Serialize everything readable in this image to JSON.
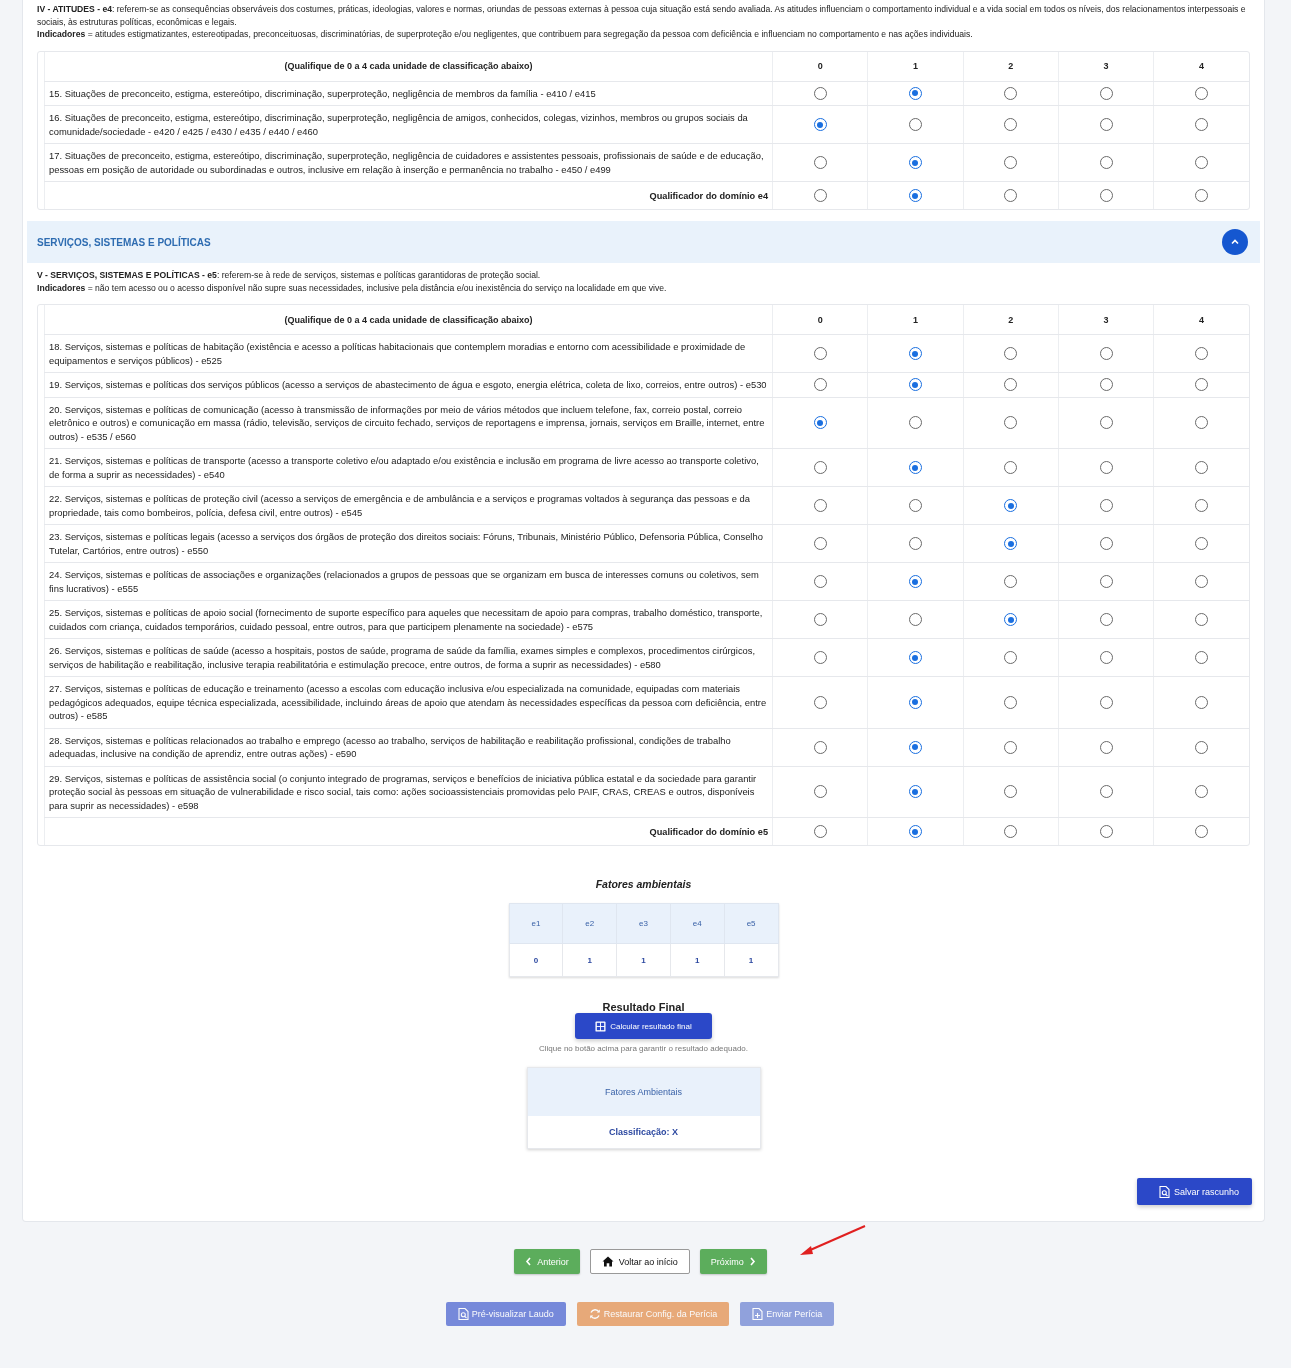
{
  "sections": [
    {
      "paragraphs": [
        "**IV - ATITUDES - e4**: referem-se as consequências observáveis dos costumes, práticas, ideologias, valores e normas, oriundas de pessoas externas à pessoa cuja situação está sendo avaliada. As atitudes influenciam o comportamento individual e a vida social em todos os níveis, dos relacionamentos interpessoais e sociais, às estruturas políticas, econômicas e legais.",
        "**Indicadores** = atitudes estigmatizantes, estereotipadas, preconceituosas, discriminatórias, de superproteção e/ou negligentes, que contribuem para segregação da pessoa com deficiência e influenciam no comportamento e nas ações individuais."
      ],
      "table": {
        "header": "(Qualifique de 0 a 4 cada unidade de classificação abaixo)",
        "scale": [
          "0",
          "1",
          "2",
          "3",
          "4"
        ],
        "rows": [
          {
            "text": "15. Situações de preconceito, estigma, estereótipo, discriminação, superproteção, negligência de membros da família - e410 / e415",
            "choices": [
              {
                "selected": false
              },
              {
                "selected": true
              },
              {
                "selected": false
              },
              {
                "selected": false
              },
              {
                "selected": false
              }
            ]
          },
          {
            "text": "16. Situações de preconceito, estigma, estereótipo, discriminação, superproteção, negligência de amigos, conhecidos, colegas, vizinhos, membros ou grupos sociais da comunidade/sociedade - e420 / e425 / e430 / e435 / e440 / e460",
            "choices": [
              {
                "selected": true
              },
              {
                "selected": false
              },
              {
                "selected": false
              },
              {
                "selected": false
              },
              {
                "selected": false
              }
            ]
          },
          {
            "text": "17. Situações de preconceito, estigma, estereótipo, discriminação, superproteção, negligência de cuidadores e assistentes pessoais, profissionais de saúde e de educação, pessoas em posição de autoridade ou subordinadas e outros, inclusive em relação à inserção e permanência no trabalho - e450 / e499",
            "choices": [
              {
                "selected": false
              },
              {
                "selected": true
              },
              {
                "selected": false
              },
              {
                "selected": false
              },
              {
                "selected": false
              }
            ]
          }
        ],
        "qualifier": {
          "label": "Qualificador do domínio e4",
          "choices": [
            {
              "selected": false
            },
            {
              "selected": true
            },
            {
              "selected": false
            },
            {
              "selected": false
            },
            {
              "selected": false
            }
          ]
        }
      }
    },
    {
      "title": "SERVIÇOS, SISTEMAS E POLÍTICAS",
      "expanded": true,
      "paragraphs": [
        "**V - SERVIÇOS, SISTEMAS E POLÍTICAS - e5**: referem-se à rede de serviços, sistemas e políticas garantidoras de proteção social.",
        "**Indicadores** = não tem acesso ou o acesso disponível não supre suas necessidades, inclusive pela distância e/ou inexistência do serviço na localidade em que vive."
      ],
      "table": {
        "header": "(Qualifique de 0 a 4 cada unidade de classificação abaixo)",
        "scale": [
          "0",
          "1",
          "2",
          "3",
          "4"
        ],
        "rows": [
          {
            "text": "18. Serviços, sistemas e políticas de habitação (existência e acesso a políticas habitacionais que contemplem moradias e entorno com acessibilidade e proximidade de equipamentos e serviços públicos) - e525",
            "choices": [
              {
                "selected": false
              },
              {
                "selected": true
              },
              {
                "selected": false
              },
              {
                "selected": false
              },
              {
                "selected": false
              }
            ]
          },
          {
            "text": "19. Serviços, sistemas e políticas dos serviços públicos (acesso a serviços de abastecimento de água e esgoto, energia elétrica, coleta de lixo, correios, entre outros) - e530",
            "choices": [
              {
                "selected": false
              },
              {
                "selected": true
              },
              {
                "selected": false
              },
              {
                "selected": false
              },
              {
                "selected": false
              }
            ]
          },
          {
            "text": "20. Serviços, sistemas e políticas de comunicação (acesso à transmissão de informações por meio de vários métodos que incluem telefone, fax, correio postal, correio eletrônico e outros) e comunicação em massa (rádio, televisão, serviços de circuito fechado, serviços de reportagens e imprensa, jornais, serviços em Braille, internet, entre outros) - e535 / e560",
            "choices": [
              {
                "selected": true
              },
              {
                "selected": false
              },
              {
                "selected": false
              },
              {
                "selected": false
              },
              {
                "selected": false
              }
            ]
          },
          {
            "text": "21. Serviços, sistemas e políticas de transporte (acesso a transporte coletivo e/ou adaptado e/ou existência e inclusão em programa de livre acesso ao transporte coletivo, de forma a suprir as necessidades) - e540",
            "choices": [
              {
                "selected": false
              },
              {
                "selected": true
              },
              {
                "selected": false
              },
              {
                "selected": false
              },
              {
                "selected": false
              }
            ]
          },
          {
            "text": "22. Serviços, sistemas e políticas de proteção civil (acesso a serviços de emergência e de ambulância e a serviços e programas voltados à segurança das pessoas e da propriedade, tais como bombeiros, polícia, defesa civil, entre outros) - e545",
            "choices": [
              {
                "selected": false
              },
              {
                "selected": false
              },
              {
                "selected": true
              },
              {
                "selected": false
              },
              {
                "selected": false
              }
            ]
          },
          {
            "text": "23. Serviços, sistemas e políticas legais (acesso a serviços dos órgãos de proteção dos direitos sociais: Fóruns, Tribunais, Ministério Público, Defensoria Pública, Conselho Tutelar, Cartórios, entre outros) - e550",
            "choices": [
              {
                "selected": false
              },
              {
                "selected": false
              },
              {
                "selected": true
              },
              {
                "selected": false
              },
              {
                "selected": false
              }
            ]
          },
          {
            "text": "24. Serviços, sistemas e políticas de associações e organizações (relacionados a grupos de pessoas que se organizam em busca de interesses comuns ou coletivos, sem fins lucrativos) - e555",
            "choices": [
              {
                "selected": false
              },
              {
                "selected": true
              },
              {
                "selected": false
              },
              {
                "selected": false
              },
              {
                "selected": false
              }
            ]
          },
          {
            "text": "25. Serviços, sistemas e políticas de apoio social (fornecimento de suporte específico para aqueles que necessitam de apoio para compras, trabalho doméstico, transporte, cuidados com criança, cuidados temporários, cuidado pessoal, entre outros, para que participem plenamente na sociedade) - e575",
            "choices": [
              {
                "selected": false
              },
              {
                "selected": false
              },
              {
                "selected": true
              },
              {
                "selected": false
              },
              {
                "selected": false
              }
            ]
          },
          {
            "text": "26. Serviços, sistemas e políticas de saúde (acesso a hospitais, postos de saúde, programa de saúde da família, exames simples e complexos, procedimentos cirúrgicos, serviços de habilitação e reabilitação, inclusive terapia reabilitatória e estimulação precoce, entre outros, de forma a suprir as necessidades) - e580",
            "choices": [
              {
                "selected": false
              },
              {
                "selected": true
              },
              {
                "selected": false
              },
              {
                "selected": false
              },
              {
                "selected": false
              }
            ]
          },
          {
            "text": "27. Serviços, sistemas e políticas de educação e treinamento (acesso a escolas com educação inclusiva e/ou especializada na comunidade, equipadas com materiais pedagógicos adequados, equipe técnica especializada, acessibilidade, incluindo áreas de apoio que atendam às necessidades específicas da pessoa com deficiência, entre outros) - e585",
            "choices": [
              {
                "selected": false
              },
              {
                "selected": true
              },
              {
                "selected": false
              },
              {
                "selected": false
              },
              {
                "selected": false
              }
            ]
          },
          {
            "text": "28. Serviços, sistemas e políticas relacionados ao trabalho e emprego (acesso ao trabalho, serviços de habilitação e reabilitação profissional, condições de trabalho adequadas, inclusive na condição de aprendiz, entre outras ações) - e590",
            "choices": [
              {
                "selected": false
              },
              {
                "selected": true
              },
              {
                "selected": false
              },
              {
                "selected": false
              },
              {
                "selected": false
              }
            ]
          },
          {
            "text": "29. Serviços, sistemas e políticas de assistência social (o conjunto integrado de programas, serviços e benefícios de iniciativa pública estatal e da sociedade para garantir proteção social às pessoas em situação de vulnerabilidade e risco social, tais como: ações socioassistenciais promovidas pelo PAIF, CRAS, CREAS e outros, disponíveis para suprir as necessidades) - e598",
            "choices": [
              {
                "selected": false
              },
              {
                "selected": true
              },
              {
                "selected": false
              },
              {
                "selected": false
              },
              {
                "selected": false
              }
            ]
          }
        ],
        "qualifier": {
          "label": "Qualificador do domínio e5",
          "choices": [
            {
              "selected": false
            },
            {
              "selected": true
            },
            {
              "selected": false
            },
            {
              "selected": false
            },
            {
              "selected": false
            }
          ]
        }
      }
    }
  ],
  "summary": {
    "title": "Fatores ambientais",
    "columns": [
      "e1",
      "e2",
      "e3",
      "e4",
      "e5"
    ],
    "values": [
      "0",
      "1",
      "1",
      "1",
      "1"
    ]
  },
  "result": {
    "title": "Resultado Final",
    "button": "Calcular resultado final",
    "hint": "Clique no botão acima para garantir o resultado adequado.",
    "card_title": "Fatores Ambientais",
    "classification": "Classificação: X"
  },
  "save_button": "Salvar rascunho",
  "nav": [
    {
      "label": "Anterior",
      "kind": "prev"
    },
    {
      "label": "Voltar ao início",
      "kind": "home"
    },
    {
      "label": "Próximo",
      "kind": "next"
    }
  ],
  "actions": [
    {
      "label": "Pré-visualizar Laudo",
      "kind": "preview",
      "disabled": true
    },
    {
      "label": "Restaurar Config. da Perícia",
      "kind": "restore",
      "disabled": true
    },
    {
      "label": "Enviar Perícia",
      "kind": "send",
      "disabled": true
    }
  ]
}
